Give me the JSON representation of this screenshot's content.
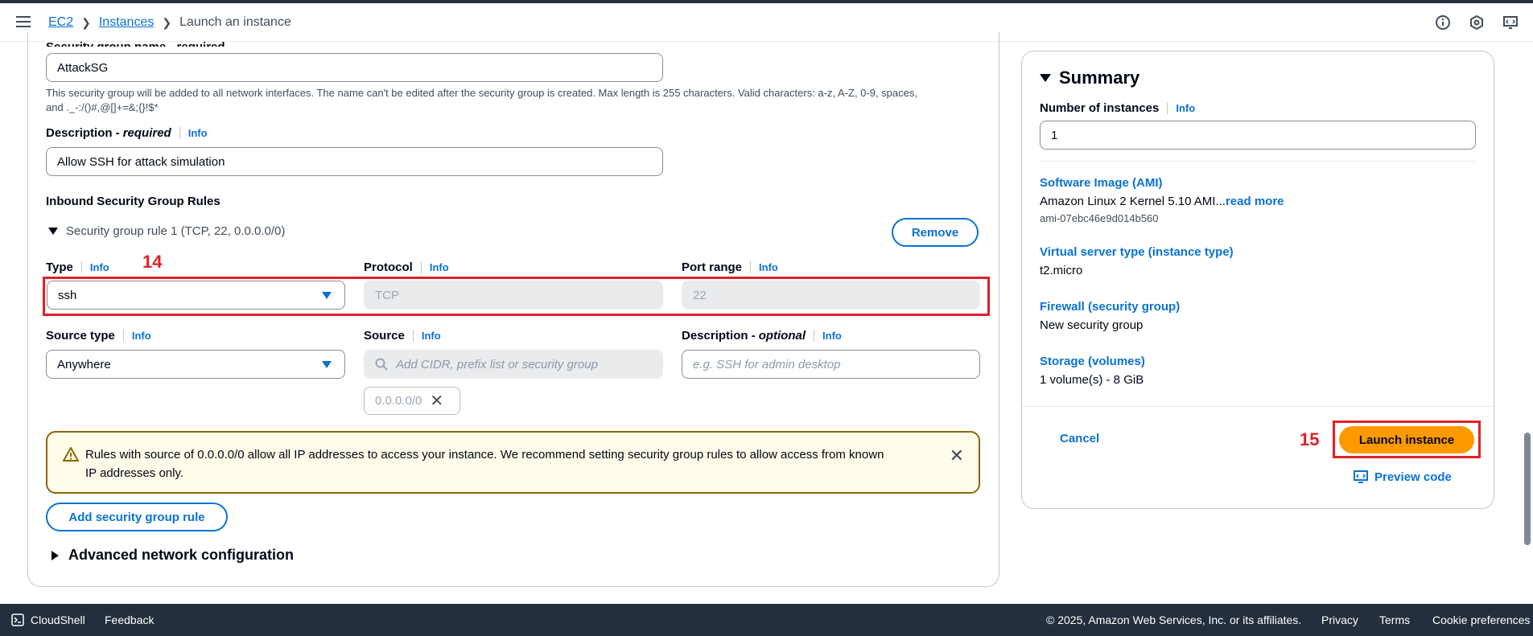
{
  "breadcrumbs": [
    "EC2",
    "Instances",
    "Launch an instance"
  ],
  "form": {
    "sg_name_label": "Security group name - required",
    "sg_name_value": "AttackSG",
    "sg_help_line1": "This security group will be added to all network interfaces. The name can't be edited after the security group is created. Max length is 255 characters. Valid characters: a-z, A-Z, 0-9, spaces,",
    "sg_help_line2": "and ._-:/()#,@[]+=&;{}!$*",
    "desc_label": "Description - ",
    "desc_label_em": "required",
    "desc_value": "Allow SSH for attack simulation",
    "info": "Info",
    "inbound_heading": "Inbound Security Group Rules",
    "rule_title": "Security group rule 1 (TCP, 22, 0.0.0.0/0)",
    "remove_label": "Remove",
    "type_label": "Type",
    "type_value": "ssh",
    "protocol_label": "Protocol",
    "protocol_value": "TCP",
    "port_label": "Port range",
    "port_value": "22",
    "source_type_label": "Source type",
    "source_type_value": "Anywhere",
    "source_label": "Source",
    "source_placeholder": "Add CIDR, prefix list or security group",
    "source_token": "0.0.0.0/0",
    "rule_desc_label": "Description - ",
    "rule_desc_label_em": "optional",
    "rule_desc_placeholder": "e.g. SSH for admin desktop",
    "warning_text": "Rules with source of 0.0.0.0/0 allow all IP addresses to access your instance. We recommend setting security group rules to allow access from known IP addresses only.",
    "add_rule_label": "Add security group rule",
    "advanced_label": "Advanced network configuration"
  },
  "annotations": {
    "a14": "14",
    "a15": "15"
  },
  "summary": {
    "title": "Summary",
    "num_instances_label": "Number of instances",
    "info": "Info",
    "num_instances_value": "1",
    "ami_label": "Software Image (AMI)",
    "ami_value": "Amazon Linux 2 Kernel 5.10 AMI...",
    "read_more": "read more",
    "ami_id": "ami-07ebc46e9d014b560",
    "type_label": "Virtual server type (instance type)",
    "type_value": "t2.micro",
    "firewall_label": "Firewall (security group)",
    "firewall_value": "New security group",
    "storage_label": "Storage (volumes)",
    "storage_value": "1 volume(s) - 8 GiB",
    "cancel_label": "Cancel",
    "launch_label": "Launch instance",
    "preview_label": "Preview code"
  },
  "footer": {
    "cloudshell": "CloudShell",
    "feedback": "Feedback",
    "copyright": "© 2025, Amazon Web Services, Inc. or its affiliates.",
    "privacy": "Privacy",
    "terms": "Terms",
    "cookies": "Cookie preferences"
  },
  "colors": {
    "accent": "#0972d3",
    "primary_button": "#ff9900",
    "annotation": "#e0202a",
    "warning_border": "#8d6605"
  }
}
